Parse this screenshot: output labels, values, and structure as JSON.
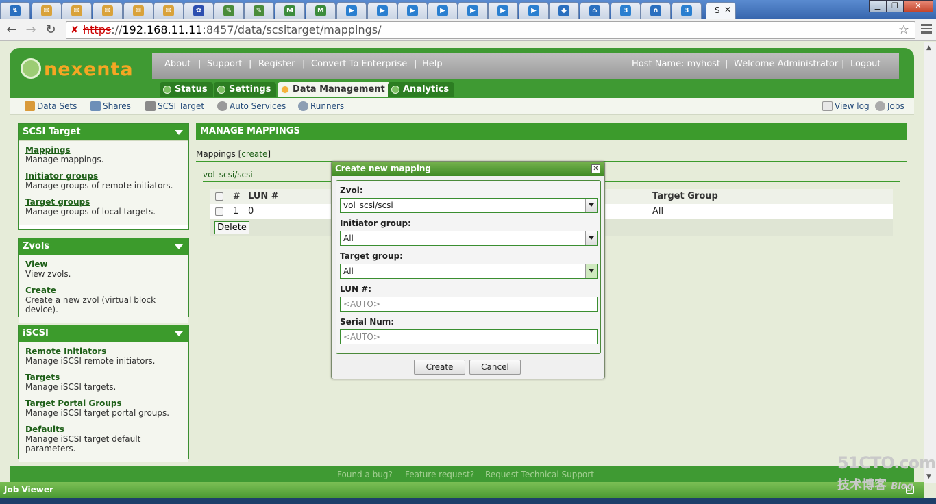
{
  "browser": {
    "active_tab_label": "S",
    "url_protocol": "https",
    "url_host": "192.168.11.11",
    "url_port_path": ":8457/data/scsitarget/mappings/",
    "window_buttons": [
      "▁",
      "❐",
      "✕"
    ]
  },
  "tabs_favicons": [
    {
      "name": "photo-tab-icon",
      "glyph": "↯",
      "color": "#2a6fbf"
    },
    {
      "name": "mail-tab-icon",
      "glyph": "✉",
      "color": "#d9a23a"
    },
    {
      "name": "mail-tab-icon",
      "glyph": "✉",
      "color": "#d9a23a"
    },
    {
      "name": "mail-tab-icon",
      "glyph": "✉",
      "color": "#d9a23a"
    },
    {
      "name": "mail-tab-icon",
      "glyph": "✉",
      "color": "#d9a23a"
    },
    {
      "name": "mail-tab-icon",
      "glyph": "✉",
      "color": "#d9a23a"
    },
    {
      "name": "paw-tab-icon",
      "glyph": "✿",
      "color": "#2d4fb0"
    },
    {
      "name": "edit-tab-icon",
      "glyph": "✎",
      "color": "#4a8c3a"
    },
    {
      "name": "edit-tab-icon",
      "glyph": "✎",
      "color": "#4a8c3a"
    },
    {
      "name": "mx-tab-icon",
      "glyph": "M",
      "color": "#3c8c3c"
    },
    {
      "name": "mx-tab-icon",
      "glyph": "M",
      "color": "#3c8c3c"
    },
    {
      "name": "play-tab-icon",
      "glyph": "▶",
      "color": "#2a7fd0"
    },
    {
      "name": "play-tab-icon",
      "glyph": "▶",
      "color": "#2a7fd0"
    },
    {
      "name": "play-tab-icon",
      "glyph": "▶",
      "color": "#2a7fd0"
    },
    {
      "name": "play-tab-icon",
      "glyph": "▶",
      "color": "#2a7fd0"
    },
    {
      "name": "play-tab-icon",
      "glyph": "▶",
      "color": "#2a7fd0"
    },
    {
      "name": "play-tab-icon",
      "glyph": "▶",
      "color": "#2a7fd0"
    },
    {
      "name": "play-tab-icon",
      "glyph": "▶",
      "color": "#2a7fd0"
    },
    {
      "name": "shield-tab-icon",
      "glyph": "◆",
      "color": "#2a6fbf"
    },
    {
      "name": "home-tab-icon",
      "glyph": "⌂",
      "color": "#2a6fbf"
    },
    {
      "name": "box-tab-icon",
      "glyph": "3",
      "color": "#2a7fd0"
    },
    {
      "name": "headset-tab-icon",
      "glyph": "∩",
      "color": "#2a6fbf"
    },
    {
      "name": "box-tab-icon",
      "glyph": "3",
      "color": "#2a7fd0"
    }
  ],
  "header": {
    "logo_text": "nexenta",
    "top_links": [
      "About",
      "Support",
      "Register",
      "Convert To Enterprise",
      "Help"
    ],
    "host_label": "Host Name: myhost",
    "welcome": "Welcome Administrator",
    "logout": "Logout",
    "separator": "|"
  },
  "main_tabs": [
    "Status",
    "Settings",
    "Data Management",
    "Analytics"
  ],
  "sub_nav": {
    "items": [
      "Data Sets",
      "Shares",
      "SCSI Target",
      "Auto Services",
      "Runners"
    ],
    "view_log": "View log",
    "jobs": "Jobs"
  },
  "sidebar": {
    "scsi": {
      "title": "SCSI Target",
      "items": [
        {
          "link": "Mappings",
          "desc": "Manage mappings."
        },
        {
          "link": "Initiator groups",
          "desc": "Manage groups of remote initiators."
        },
        {
          "link": "Target groups",
          "desc": "Manage groups of local targets."
        }
      ]
    },
    "zvols": {
      "title": "Zvols",
      "items": [
        {
          "link": "View",
          "desc": "View zvols."
        },
        {
          "link": "Create",
          "desc": "Create a new zvol (virtual block device)."
        }
      ]
    },
    "iscsi": {
      "title": "iSCSI",
      "items": [
        {
          "link": "Remote Initiators",
          "desc": "Manage iSCSI remote initiators."
        },
        {
          "link": "Targets",
          "desc": "Manage iSCSI targets."
        },
        {
          "link": "Target Portal Groups",
          "desc": "Manage iSCSI target portal groups."
        },
        {
          "link": "Defaults",
          "desc": "Manage iSCSI target default parameters."
        }
      ]
    }
  },
  "main": {
    "heading": "MANAGE MAPPINGS",
    "mappings_label": "Mappings [",
    "create_link": "create",
    "mappings_close": "]",
    "volume": "vol_scsi/scsi",
    "table": {
      "headers": {
        "num": "#",
        "lun": "LUN #",
        "target_group": "Target Group"
      },
      "rows": [
        {
          "num": "1",
          "lun": "0",
          "target_group": "All"
        }
      ]
    },
    "delete_button": "Delete"
  },
  "dialog": {
    "title": "Create new mapping",
    "close_glyph": "✕",
    "zvol_label": "Zvol:",
    "zvol_value": "vol_scsi/scsi",
    "initiator_label": "Initiator group:",
    "initiator_value": "All",
    "target_label": "Target group:",
    "target_value": "All",
    "lun_label": "LUN #:",
    "lun_placeholder": "<AUTO>",
    "serial_label": "Serial Num:",
    "serial_placeholder": "<AUTO>",
    "create_button": "Create",
    "cancel_button": "Cancel"
  },
  "footer": {
    "links": [
      "Found a bug?",
      "Feature request?",
      "Request Technical Support"
    ],
    "job_viewer": "Job Viewer"
  },
  "watermark": {
    "line1": "51CTO.com",
    "line2": "技术博客",
    "blog": "Blog"
  }
}
